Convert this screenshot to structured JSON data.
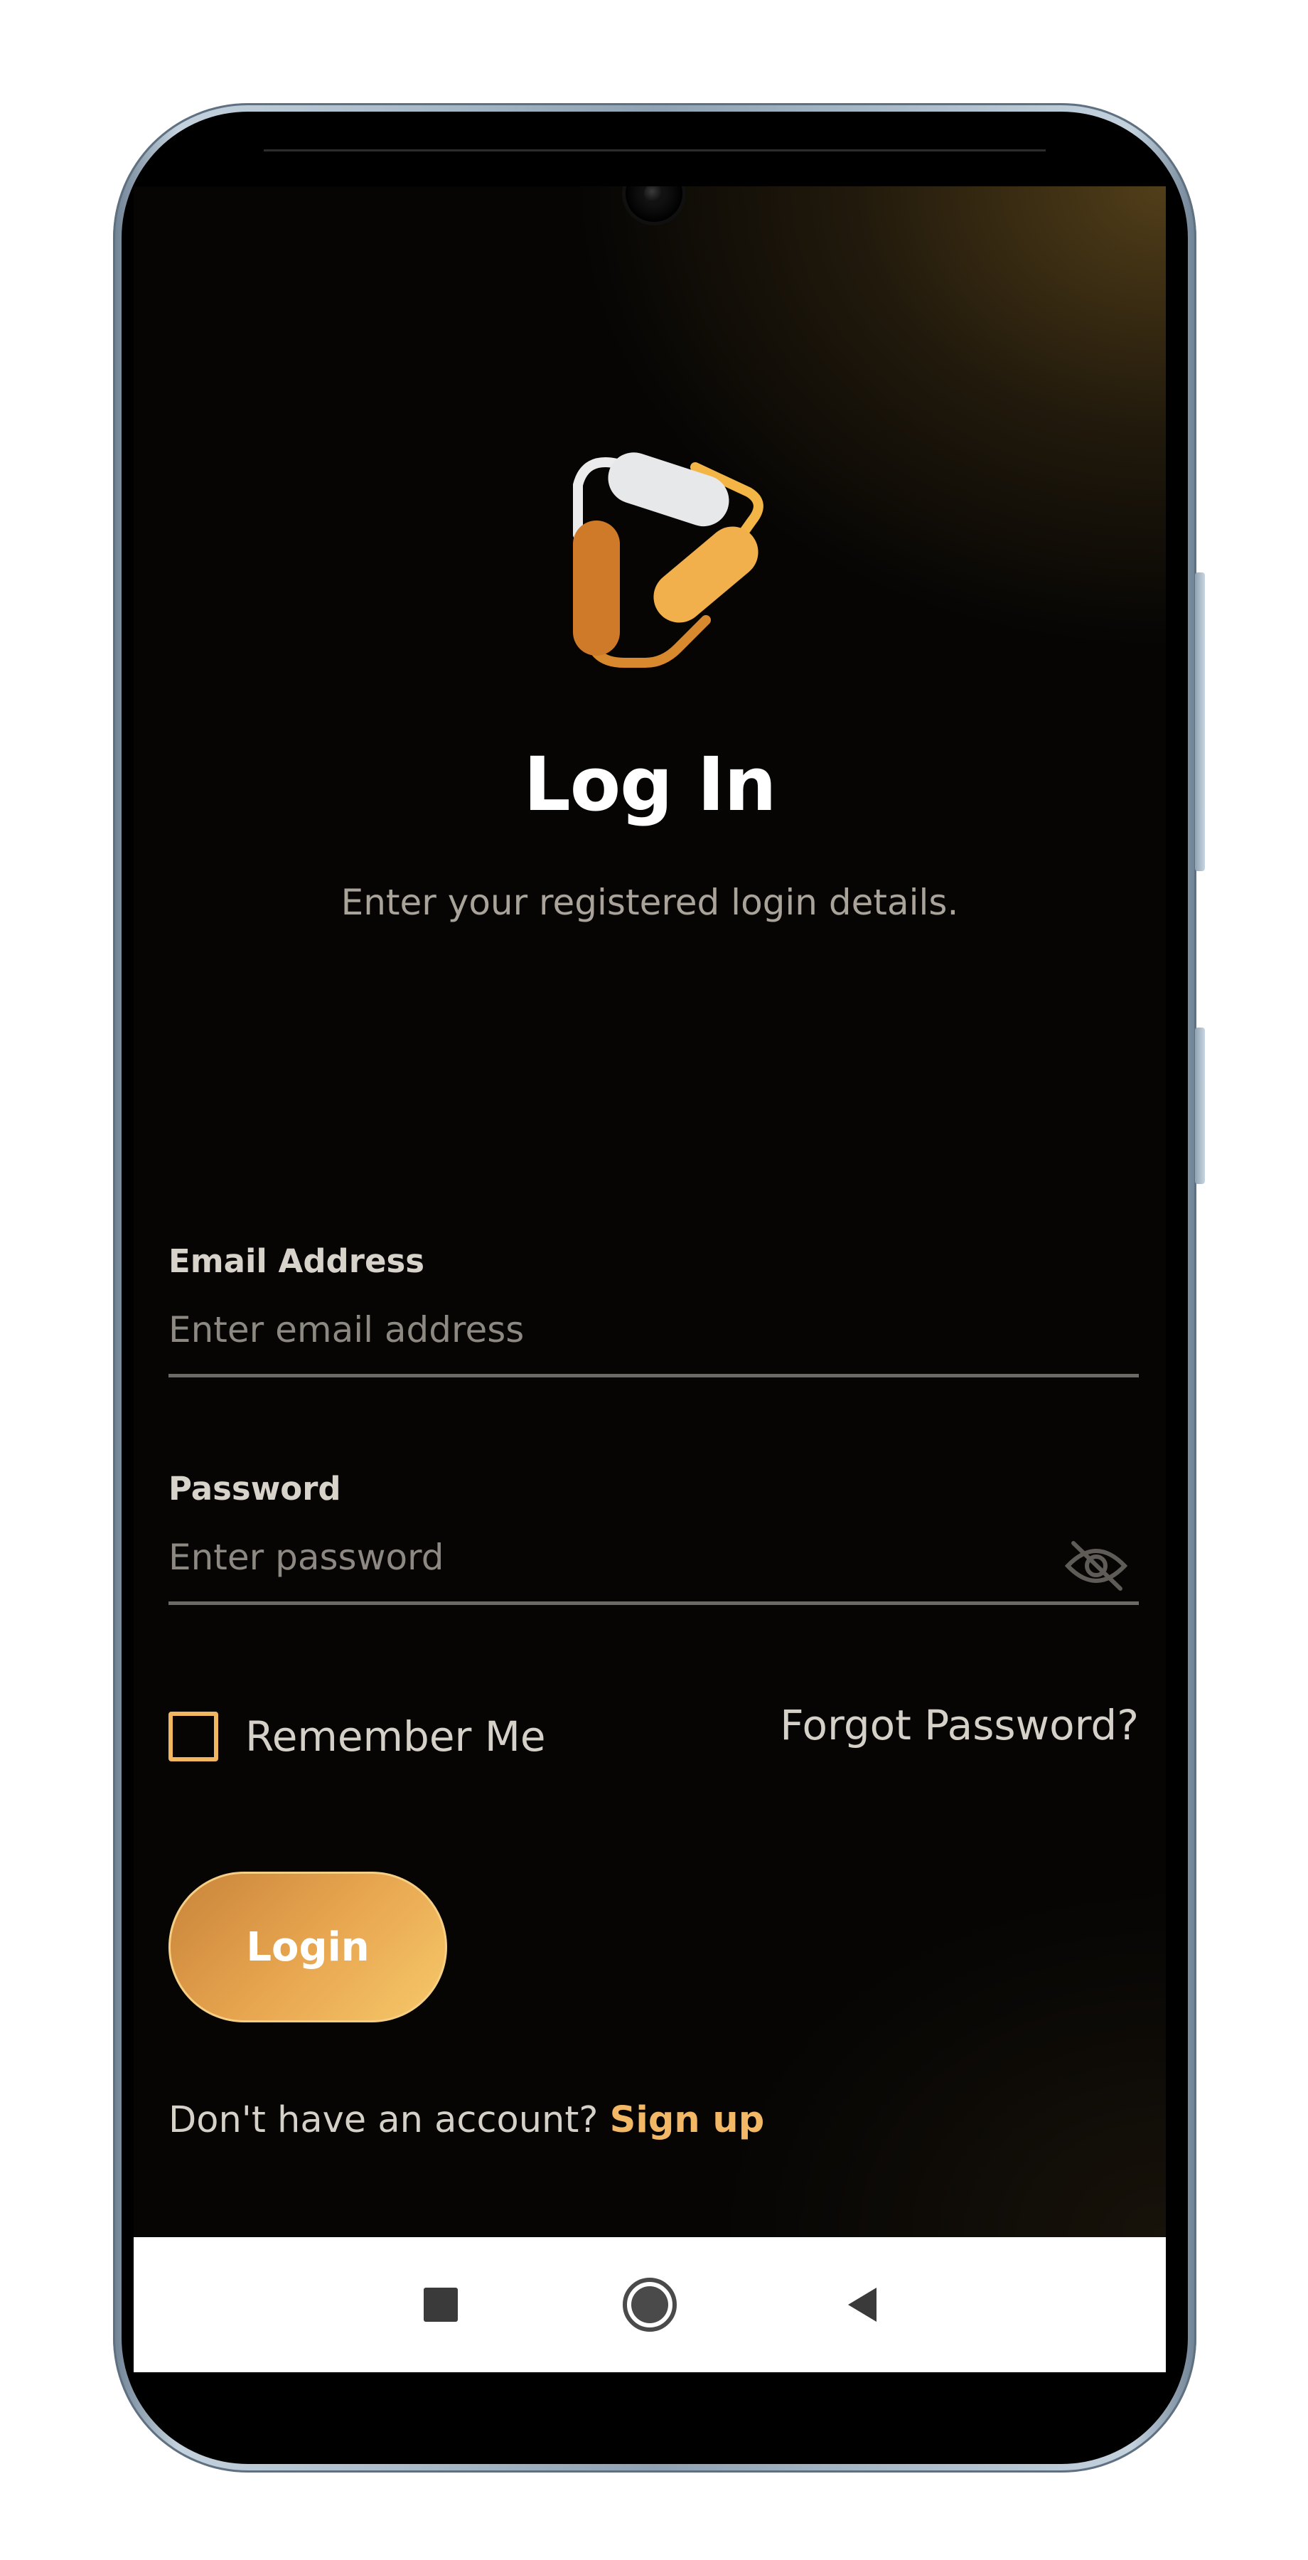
{
  "login": {
    "title": "Log In",
    "subtitle": "Enter your registered login details."
  },
  "email": {
    "label": "Email Address",
    "placeholder": "Enter email address",
    "value": ""
  },
  "password": {
    "label": "Password",
    "placeholder": "Enter password",
    "value": "",
    "toggle_icon": "eye-off-icon"
  },
  "options": {
    "remember_label": "Remember Me",
    "remember_checked": false,
    "forgot_label": "Forgot Password?"
  },
  "actions": {
    "login_label": "Login"
  },
  "signup": {
    "prompt": "Don't have an account? ",
    "link_label": "Sign up"
  },
  "navbar": {
    "icons": [
      "recents-icon",
      "home-icon",
      "back-icon"
    ]
  },
  "colors": {
    "accent": "#f2b865",
    "button_gradient_start": "#c9843a",
    "button_gradient_end": "#f7c86a",
    "background": "#060504"
  }
}
